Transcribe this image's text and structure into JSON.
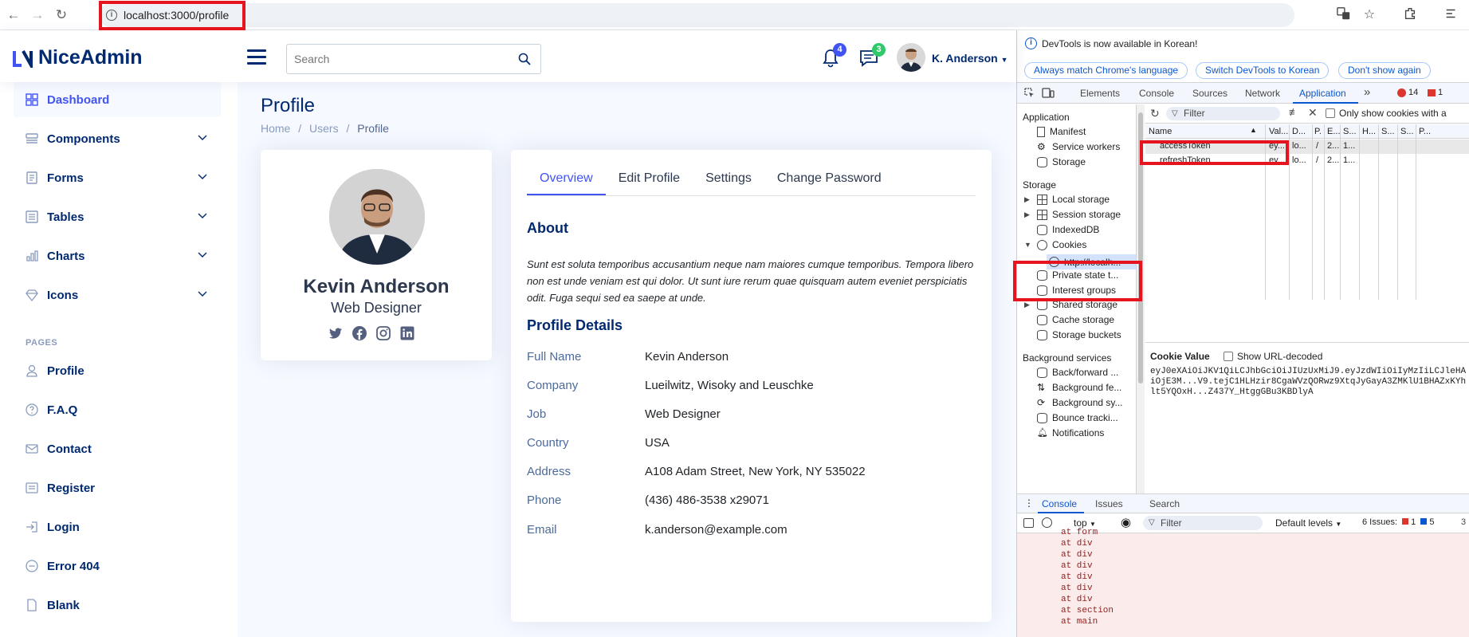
{
  "browser": {
    "url": "localhost:3000/profile",
    "back_glyph": "←",
    "forward_glyph": "→",
    "reload_glyph": "↻"
  },
  "header": {
    "logo_text": "NiceAdmin",
    "search_placeholder": "Search",
    "notif_count": "4",
    "message_count": "3",
    "user_name": "K. Anderson",
    "colors": {
      "primary": "#4154f1",
      "navy": "#012970",
      "notif_badge": "#4154f1",
      "msg_badge": "#2eca6a"
    }
  },
  "sidebar": {
    "items": [
      {
        "label": "Dashboard",
        "icon": "grid-icon"
      },
      {
        "label": "Components",
        "icon": "menu-button-icon"
      },
      {
        "label": "Forms",
        "icon": "journal-icon"
      },
      {
        "label": "Tables",
        "icon": "layout-text-icon"
      },
      {
        "label": "Charts",
        "icon": "bar-chart-icon"
      },
      {
        "label": "Icons",
        "icon": "gem-icon"
      }
    ],
    "pages_heading": "PAGES",
    "pages": [
      {
        "label": "Profile",
        "icon": "person-icon"
      },
      {
        "label": "F.A.Q",
        "icon": "question-circle-icon"
      },
      {
        "label": "Contact",
        "icon": "envelope-icon"
      },
      {
        "label": "Register",
        "icon": "card-list-icon"
      },
      {
        "label": "Login",
        "icon": "box-arrow-in-right-icon"
      },
      {
        "label": "Error 404",
        "icon": "dash-circle-icon"
      },
      {
        "label": "Blank",
        "icon": "file-icon"
      }
    ]
  },
  "main": {
    "title": "Profile",
    "breadcrumb": [
      "Home",
      "Users",
      "Profile"
    ],
    "breadcrumb_sep": "/",
    "profile_card": {
      "name": "Kevin Anderson",
      "job": "Web Designer"
    },
    "tabs": [
      "Overview",
      "Edit Profile",
      "Settings",
      "Change Password"
    ],
    "about_title": "About",
    "about_text": "Sunt est soluta temporibus accusantium neque nam maiores cumque temporibus. Tempora libero non est unde veniam est qui dolor. Ut sunt iure rerum quae quisquam autem eveniet perspiciatis odit. Fuga sequi sed ea saepe at unde.",
    "details_title": "Profile Details",
    "details": [
      {
        "label": "Full Name",
        "value": "Kevin Anderson"
      },
      {
        "label": "Company",
        "value": "Lueilwitz, Wisoky and Leuschke"
      },
      {
        "label": "Job",
        "value": "Web Designer"
      },
      {
        "label": "Country",
        "value": "USA"
      },
      {
        "label": "Address",
        "value": "A108 Adam Street, New York, NY 535022"
      },
      {
        "label": "Phone",
        "value": "(436) 486-3538 x29071"
      },
      {
        "label": "Email",
        "value": "k.anderson@example.com"
      }
    ]
  },
  "devtools": {
    "info_message": "DevTools is now available in Korean!",
    "info_buttons": [
      "Always match Chrome's language",
      "Switch DevTools to Korean",
      "Don't show again"
    ],
    "tabs": [
      "Elements",
      "Console",
      "Sources",
      "Network",
      "Application"
    ],
    "more_glyph": "»",
    "error_count": "14",
    "warning_count": "1",
    "tree": {
      "application_heading": "Application",
      "application_items": [
        "Manifest",
        "Service workers",
        "Storage"
      ],
      "storage_heading": "Storage",
      "storage_items": [
        "Local storage",
        "Session storage",
        "IndexedDB",
        "Cookies",
        "http://localh...",
        "Private state t...",
        "Interest groups",
        "Shared storage",
        "Cache storage",
        "Storage buckets"
      ],
      "background_heading": "Background services",
      "background_items": [
        "Back/forward ...",
        "Background fe...",
        "Background sy...",
        "Bounce tracki...",
        "Notifications"
      ]
    },
    "cookies": {
      "filter_placeholder": "Filter",
      "only_issues_label": "Only show cookies with a",
      "columns": [
        "Name",
        "Val...",
        "D...",
        "P.",
        "E...",
        "S...",
        "H...",
        "S...",
        "S...",
        "P..."
      ],
      "rows": [
        [
          "accessToken",
          "ey...",
          "lo...",
          "/",
          "2...",
          "1..."
        ],
        [
          "refreshToken",
          "ey...",
          "lo...",
          "/",
          "2...",
          "1..."
        ]
      ],
      "cookie_value_label": "Cookie Value",
      "show_decoded_label": "Show URL-decoded",
      "cookie_value": "eyJ0eXAiOiJKV1QiLCJhbGciOiJIUzUxMiJ9.eyJzdWIiOiIyMzIiLCJleHAiOjE3M...V9.tejC1HLHzir8CgaWVzQORwz9XtqJyGayA3ZMKlU1BHAZxKYhlt5YQOxH...Z437Y_HtggGBu3KBDlyA"
    },
    "drawer_tabs": [
      "Console",
      "Issues",
      "Search"
    ],
    "console": {
      "context": "top",
      "filter_placeholder": "Filter",
      "levels": "Default levels",
      "issues_label": "6 Issues:",
      "issue_errors": "1",
      "issue_info": "5",
      "hidden_count": "3",
      "lines": [
        "at form",
        "at div",
        "at div",
        "at div",
        "at div",
        "at div",
        "at div",
        "at section",
        "at main"
      ]
    }
  }
}
